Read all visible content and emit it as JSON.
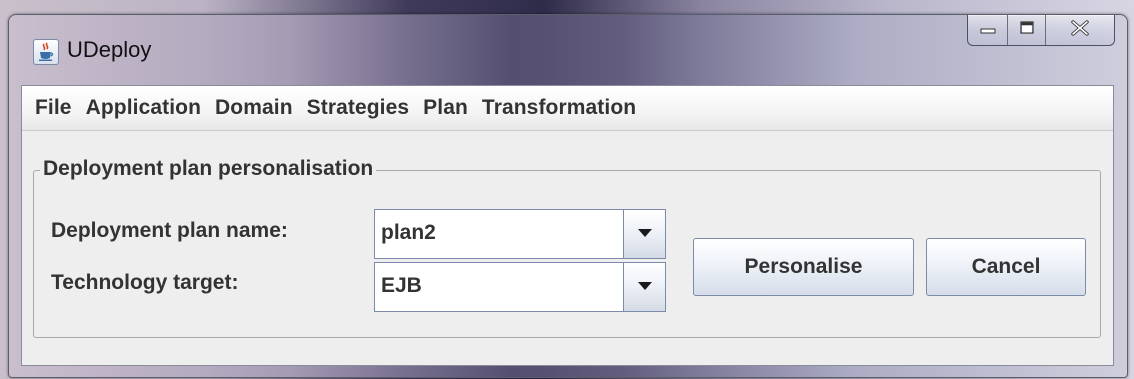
{
  "window": {
    "title": "UDeploy"
  },
  "icons": {
    "app": "java-cup-icon",
    "minimize": "minimize-icon",
    "maximize": "maximize-icon",
    "close": "close-icon",
    "dropdown": "chevron-down-icon"
  },
  "menubar": {
    "items": [
      "File",
      "Application",
      "Domain",
      "Strategies",
      "Plan",
      "Transformation"
    ]
  },
  "form": {
    "group_title": "Deployment plan personalisation",
    "plan_name_label": "Deployment plan name:",
    "plan_name_value": "plan2",
    "technology_label": "Technology target:",
    "technology_value": "EJB",
    "personalise_label": "Personalise",
    "cancel_label": "Cancel"
  },
  "colors": {
    "client_bg": "#eeeeee",
    "control_border": "#7a8aa8",
    "text": "#333333"
  }
}
